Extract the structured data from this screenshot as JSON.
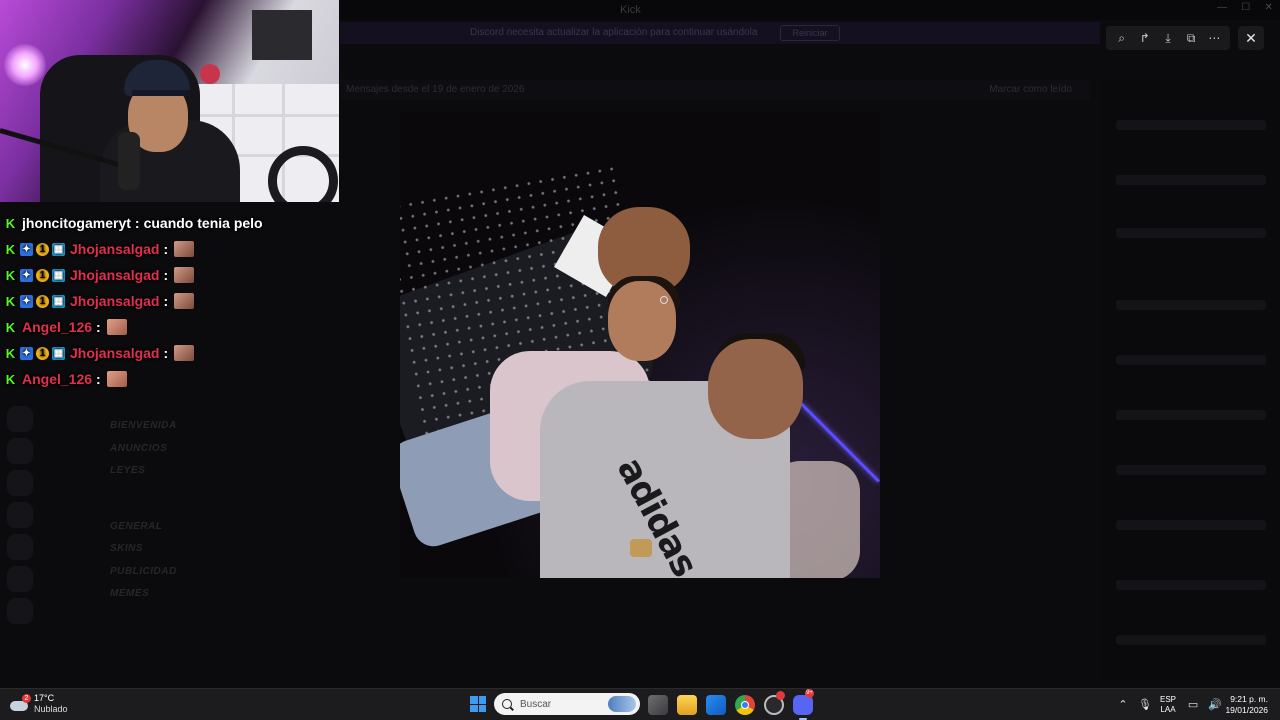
{
  "background_app": {
    "window_title": "Kick",
    "banner_text": "Discord necesita actualizar la aplicación para continuar usándola",
    "banner_button": "Reiniciar",
    "message_bar_text": "Mensajes desde el 19 de enero de 2026",
    "message_bar_action": "Marcar como leído",
    "channels": [
      "BIENVENIDA",
      "ANUNCIOS",
      "LEYES",
      "GENERAL",
      "SKINS",
      "PUBLICIDAD",
      "MEMES"
    ]
  },
  "viewer": {
    "toolbar_icons": [
      "zoom-icon",
      "share-icon",
      "download-icon",
      "open-external-icon",
      "more-icon"
    ],
    "close_icon": "close-icon"
  },
  "chat": {
    "messages": [
      {
        "user": "jhoncitogameryt",
        "user_color": "#ffffff",
        "badges": [
          "kick"
        ],
        "text": "cuando tenia pelo",
        "emote": false
      },
      {
        "user": "Jhojansalgad",
        "user_color": "#e0304e",
        "badges": [
          "kick",
          "b1",
          "b2",
          "b3"
        ],
        "text": "",
        "emote": true
      },
      {
        "user": "Jhojansalgad",
        "user_color": "#e0304e",
        "badges": [
          "kick",
          "b1",
          "b2",
          "b3"
        ],
        "text": "",
        "emote": true
      },
      {
        "user": "Jhojansalgad",
        "user_color": "#e0304e",
        "badges": [
          "kick",
          "b1",
          "b2",
          "b3"
        ],
        "text": "",
        "emote": true
      },
      {
        "user": "Angel_126",
        "user_color": "#e0304e",
        "badges": [
          "kick"
        ],
        "text": "",
        "emote": true
      },
      {
        "user": "Jhojansalgad",
        "user_color": "#e0304e",
        "badges": [
          "kick",
          "b1",
          "b2",
          "b3"
        ],
        "text": "",
        "emote": true
      },
      {
        "user": "Angel_126",
        "user_color": "#e0304e",
        "badges": [
          "kick"
        ],
        "text": "",
        "emote": true
      }
    ]
  },
  "taskbar": {
    "weather": {
      "temp": "17°C",
      "condition": "Nublado",
      "badge": "2"
    },
    "search_placeholder": "Buscar",
    "discord_badge": "9+",
    "lang_top": "ESP",
    "lang_bottom": "LAA",
    "time": "9:21 p. m.",
    "date": "19/01/2026"
  },
  "colors": {
    "accent": "#53fc18",
    "username_red": "#e0304e",
    "discord": "#5865f2"
  }
}
